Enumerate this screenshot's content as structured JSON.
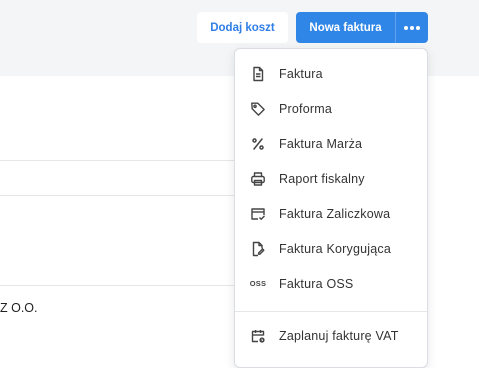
{
  "header": {
    "add_cost_label": "Dodaj koszt",
    "new_invoice_label": "Nowa faktura"
  },
  "content": {
    "row_text": "Z O.O."
  },
  "dropdown": {
    "items": [
      {
        "label": "Faktura",
        "icon": "document-icon"
      },
      {
        "label": "Proforma",
        "icon": "tag-icon"
      },
      {
        "label": "Faktura Marża",
        "icon": "percent-icon"
      },
      {
        "label": "Raport fiskalny",
        "icon": "printer-icon"
      },
      {
        "label": "Faktura Zaliczkowa",
        "icon": "card-check-icon"
      },
      {
        "label": "Faktura Korygująca",
        "icon": "document-edit-icon"
      },
      {
        "label": "Faktura OSS",
        "icon": "oss-icon",
        "icon_text": "OSS"
      },
      {
        "label": "Zaplanuj fakturę VAT",
        "icon": "calendar-clock-icon"
      }
    ]
  },
  "colors": {
    "primary": "#2f86e6",
    "link": "#2f7ee6",
    "topbar_bg": "#f4f5f7"
  }
}
